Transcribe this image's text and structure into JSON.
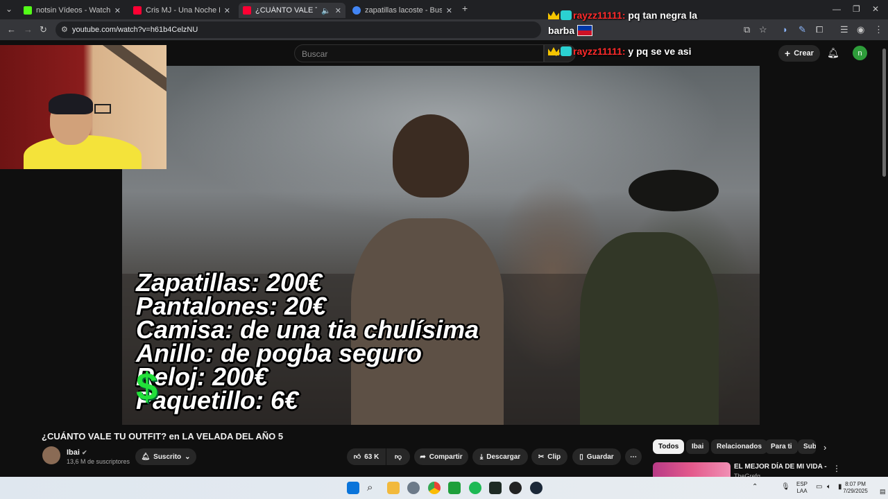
{
  "browser": {
    "tabs": [
      {
        "title": "notsin Vídeos - Watch On-Dem",
        "favicon_color": "#53fc18",
        "active": false
      },
      {
        "title": "Cris MJ - Una Noche En Medell",
        "favicon_color": "#ff0033",
        "active": false
      },
      {
        "title": "¿CUÁNTO VALE TU OUTFIT",
        "favicon_color": "#ff0033",
        "active": true
      },
      {
        "title": "zapatillas lacoste - Buscar con G",
        "favicon_color": "#4285f4",
        "active": false
      }
    ],
    "new_tab_label": "+",
    "url": "youtube.com/watch?v=h61b4CelzNU"
  },
  "youtube": {
    "search_placeholder": "Buscar",
    "create_label": "Crear",
    "avatar_letter": "n",
    "video_title": "¿CUÁNTO VALE TU OUTFIT? en LA VELADA DEL AÑO 5",
    "channel": {
      "name": "Ibai",
      "subscribers": "13,6 M de suscriptores"
    },
    "subscribed_label": "Suscrito",
    "likes": "63 K",
    "actions": {
      "share": "Compartir",
      "download": "Descargar",
      "clip": "Clip",
      "save": "Guardar",
      "more": "⋯"
    },
    "chips": [
      "Todos",
      "Ibai",
      "Relacionados",
      "Para ti",
      "Sub"
    ],
    "recommendation": {
      "title": "EL MEJOR DÍA DE MI VIDA -",
      "channel": "TheGrefg"
    }
  },
  "video_overlay": {
    "lines": [
      "Zapatillas: 200€",
      "Pantalones: 20€",
      "Camisa: de una tia chulísima",
      "Anillo: de pogba seguro",
      "Reloj: 200€",
      "Paquetillo: 6€"
    ],
    "dollar_symbol": "$"
  },
  "chat": [
    {
      "user": "rayzz11111:",
      "message_line1": "pq tan negra la",
      "message_line2": "barba"
    },
    {
      "user": "rayzz11111:",
      "message_line1": "y pq se ve asi"
    }
  ],
  "taskbar": {
    "language": "ESP",
    "language_sub": "LAA",
    "time": "8:07 PM",
    "date": "7/29/2025"
  },
  "colors": {
    "accent_green": "#22e03a",
    "chat_user": "#ff2a2a",
    "crown": "#f5c400"
  }
}
